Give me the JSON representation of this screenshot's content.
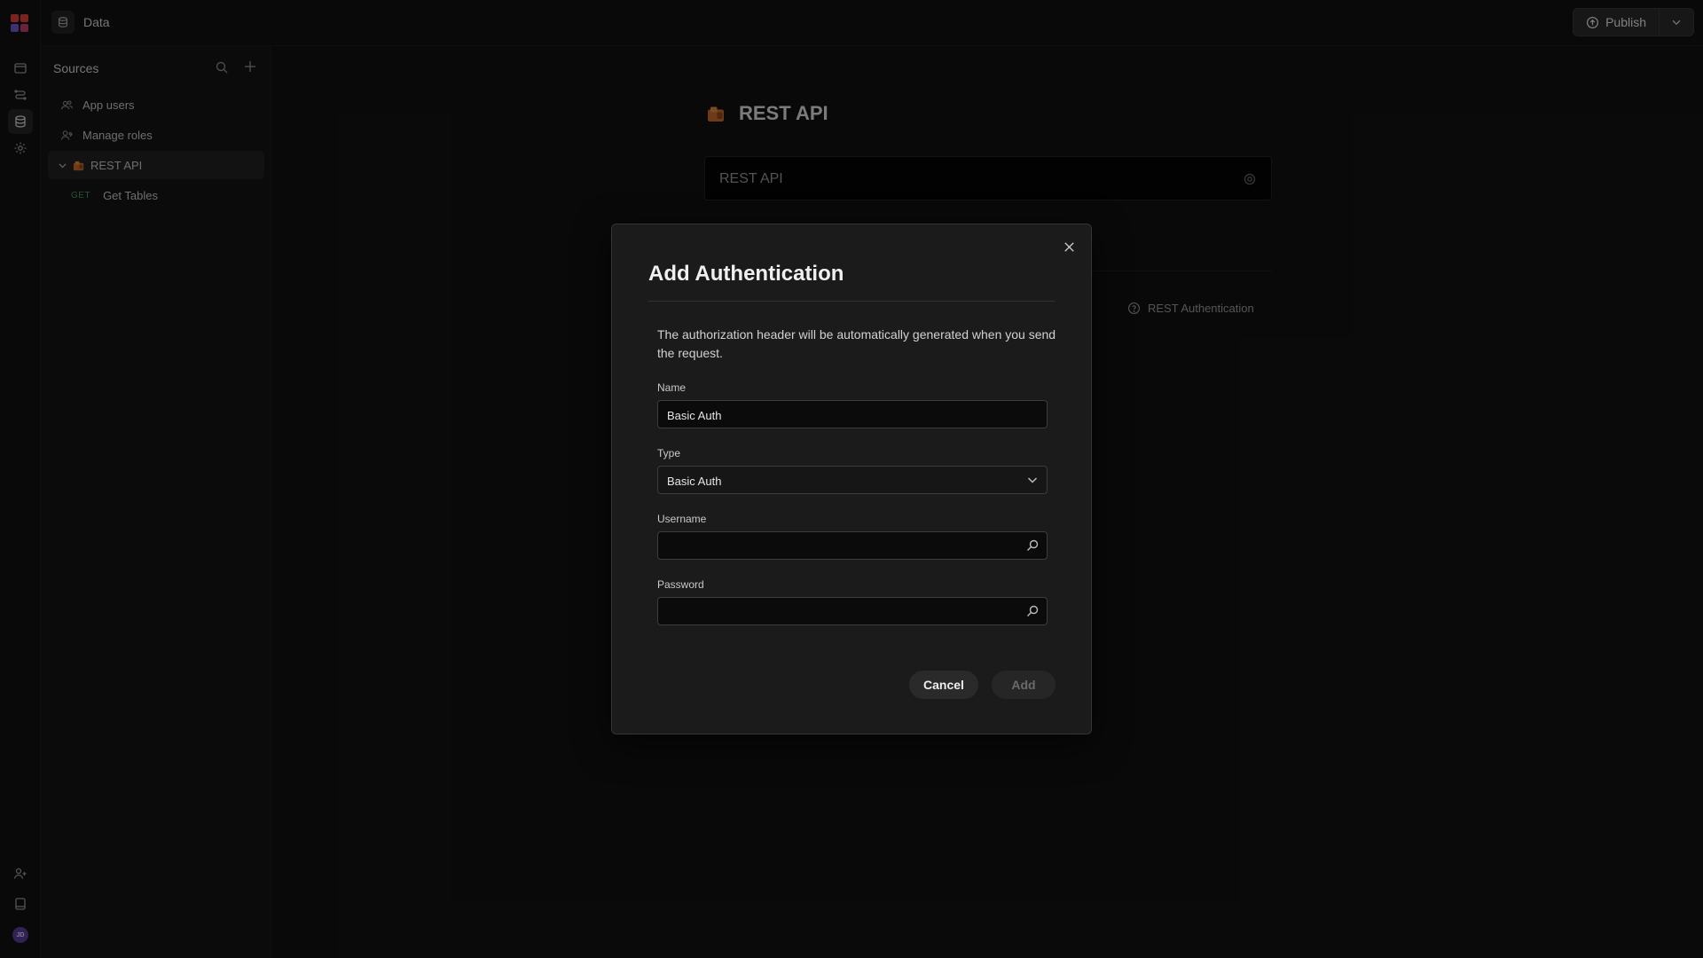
{
  "topbar": {
    "section_title": "Data",
    "publish_label": "Publish"
  },
  "sources": {
    "title": "Sources",
    "items": [
      {
        "label": "App users",
        "icon": "users-icon"
      },
      {
        "label": "Manage roles",
        "icon": "user-roles-icon"
      },
      {
        "label": "REST API",
        "icon": "rest-api-icon",
        "expanded": true,
        "selected": true
      },
      {
        "label": "Get Tables",
        "method": "GET"
      }
    ]
  },
  "main": {
    "heading": "REST API",
    "name_field_value": "REST API",
    "help_link": "REST Authentication"
  },
  "modal": {
    "title": "Add Authentication",
    "description": "The authorization header will be automatically generated when you send the request.",
    "fields": {
      "name": {
        "label": "Name",
        "value": "Basic Auth"
      },
      "type": {
        "label": "Type",
        "value": "Basic Auth"
      },
      "username": {
        "label": "Username",
        "value": ""
      },
      "password": {
        "label": "Password",
        "value": ""
      }
    },
    "cancel_label": "Cancel",
    "add_label": "Add"
  },
  "user": {
    "initials": "JD"
  },
  "colors": {
    "get_method": "#3f9e5c",
    "avatar": "#5b3c9a",
    "logo_red": "#e0413a",
    "logo_purple": "#6d5bd0"
  }
}
